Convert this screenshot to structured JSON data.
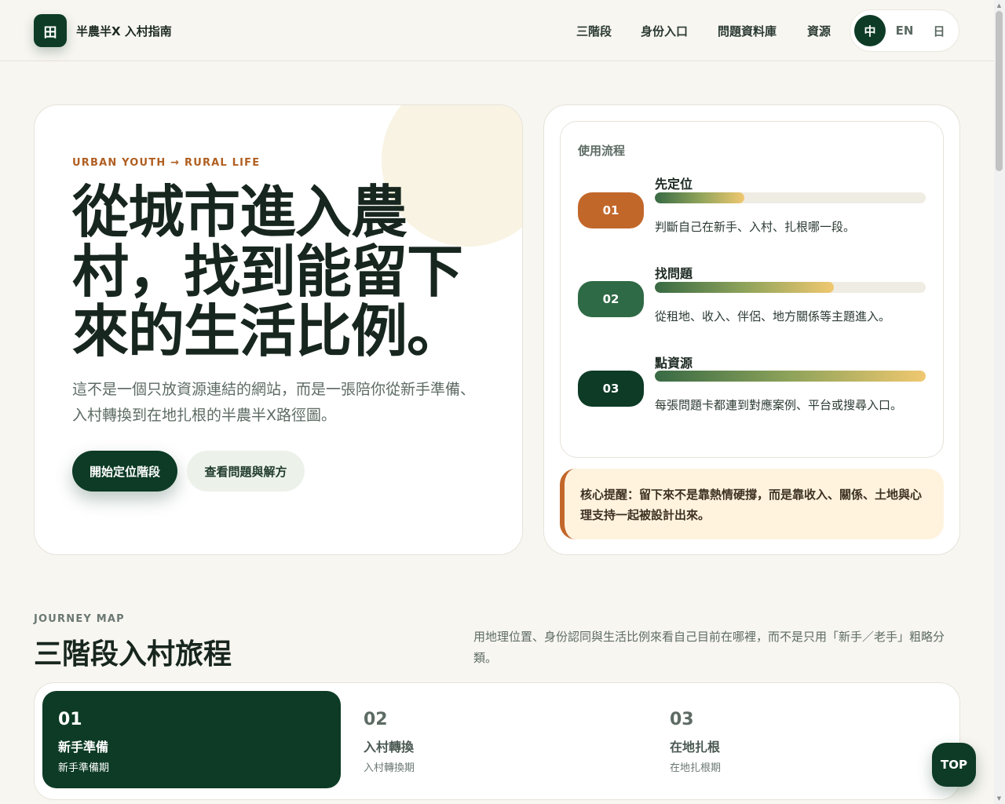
{
  "header": {
    "logo_glyph": "田",
    "brand": "半農半X 入村指南",
    "nav": [
      "三階段",
      "身份入口",
      "問題資料庫",
      "資源"
    ],
    "languages": [
      {
        "label": "中",
        "active": true
      },
      {
        "label": "EN",
        "active": false
      },
      {
        "label": "日",
        "active": false
      }
    ]
  },
  "hero": {
    "eyebrow": "URBAN YOUTH → RURAL LIFE",
    "title": "從城市進入農村，找到能留下來的生活比例。",
    "description": "這不是一個只放資源連結的網站，而是一張陪你從新手準備、入村轉換到在地扎根的半農半X路徑圖。",
    "primary_button": "開始定位階段",
    "secondary_button": "查看問題與解方"
  },
  "flow": {
    "title": "使用流程",
    "steps": [
      {
        "badge": "01",
        "name": "先定位",
        "description": "判斷自己在新手、入村、扎根哪一段。",
        "progress": 0.33,
        "badge_color": "#c2672a"
      },
      {
        "badge": "02",
        "name": "找問題",
        "description": "從租地、收入、伴侶、地方關係等主題進入。",
        "progress": 0.66,
        "badge_color": "#2e6a45"
      },
      {
        "badge": "03",
        "name": "點資源",
        "description": "每張問題卡都連到對應案例、平台或搜尋入口。",
        "progress": 1.0,
        "badge_color": "#0d3b26"
      }
    ],
    "reminder": "核心提醒：留下來不是靠熱情硬撐，而是靠收入、關係、土地與心理支持一起被設計出來。"
  },
  "journey": {
    "eyebrow": "JOURNEY MAP",
    "title": "三階段入村旅程",
    "description": "用地理位置、身份認同與生活比例來看自己目前在哪裡，而不是只用「新手／老手」粗略分類。",
    "stages": [
      {
        "num": "01",
        "name": "新手準備",
        "sub": "新手準備期",
        "active": true
      },
      {
        "num": "02",
        "name": "入村轉換",
        "sub": "入村轉換期",
        "active": false
      },
      {
        "num": "03",
        "name": "在地扎根",
        "sub": "在地扎根期",
        "active": false
      }
    ]
  },
  "top_button": "TOP",
  "colors": {
    "brand_dark": "#0d3b26",
    "accent_orange": "#c2672a",
    "background": "#f8f6f1"
  }
}
